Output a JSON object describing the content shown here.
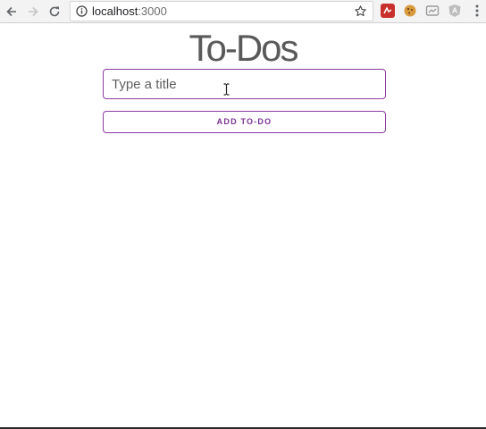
{
  "browser": {
    "url_host": "localhost",
    "url_port": ":3000",
    "icons": {
      "back": "back-arrow-icon",
      "forward": "forward-arrow-icon",
      "reload": "reload-icon",
      "info": "info-icon",
      "bookmark": "star-icon",
      "menu": "kebab-menu-icon"
    },
    "extensions": [
      "red-extension-icon",
      "cookie-extension-icon",
      "cast-extension-icon",
      "angular-extension-icon"
    ]
  },
  "page": {
    "title": "To-Dos",
    "input_placeholder": "Type a title",
    "add_button_label": "ADD TO-DO"
  },
  "colors": {
    "accent": "#8e3ba3",
    "title_text": "#5a5a5a"
  }
}
